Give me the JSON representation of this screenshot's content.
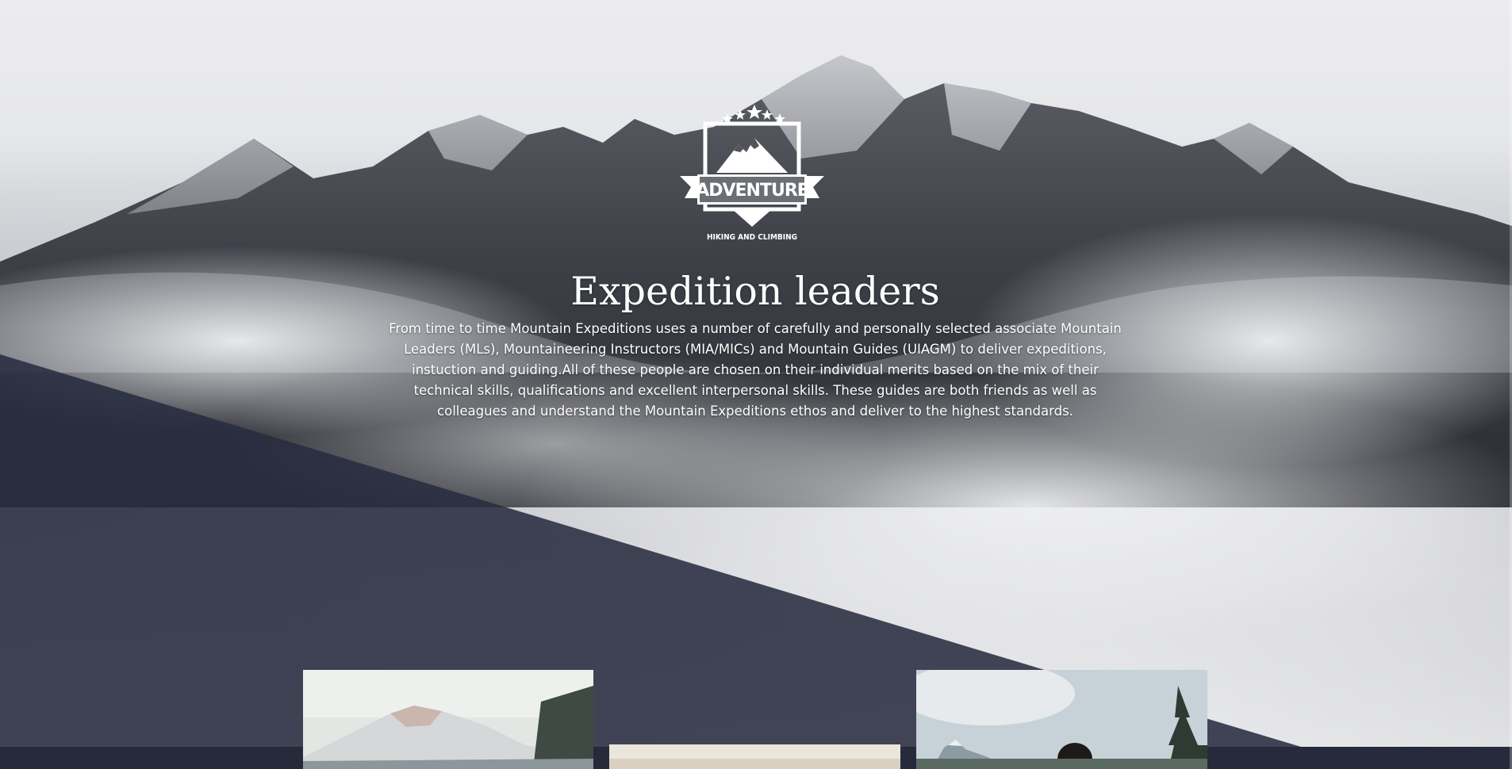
{
  "logo": {
    "brand": "ADVENTURE",
    "tagline": "HIKING AND CLIMBING",
    "icon": "mountain-badge-icon"
  },
  "hero": {
    "title": "Expedition leaders",
    "description": "From time to time Mountain Expeditions uses a number of carefully and personally selected associate Mountain Leaders (MLs), Mountaineering Instructors (MIA/MICs) and Mountain Guides (UIAGM) to deliver expeditions, instuction and guiding.All of these people are chosen on their individual merits based on the mix of their technical skills, qualifications and excellent interpersonal skills. These guides are both friends as well as colleagues and understand the Mountain Expeditions ethos and deliver to the highest standards."
  },
  "colors": {
    "band": "#2f3346",
    "text": "#ffffff"
  }
}
